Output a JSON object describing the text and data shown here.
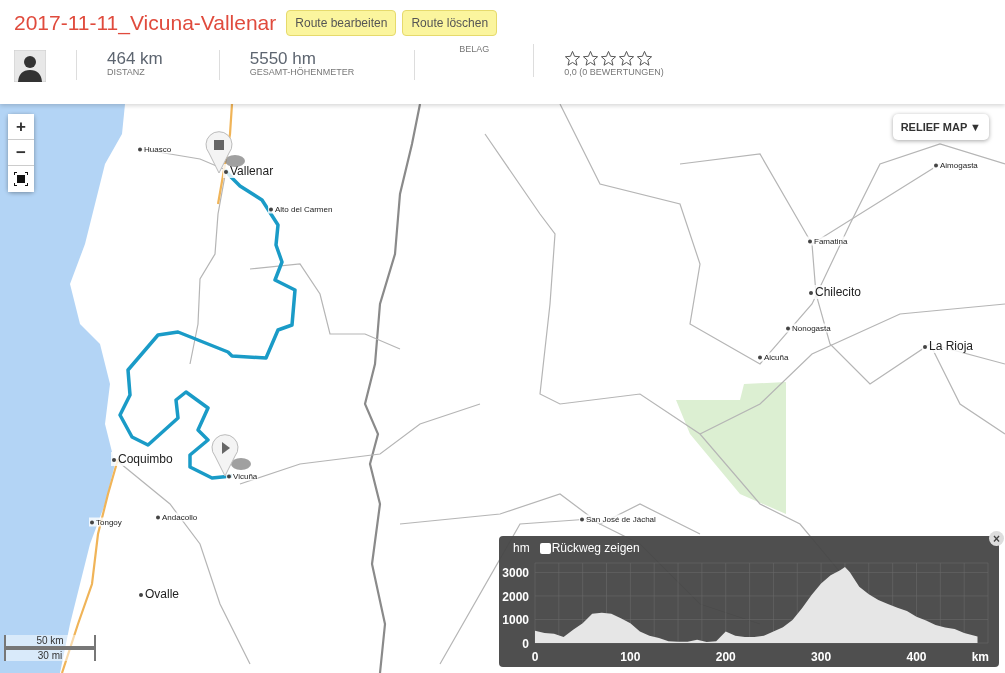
{
  "route": {
    "title": "2017-11-11_Vicuna-Vallenar",
    "buttons": [
      "Route bearbeiten",
      "Route löschen"
    ]
  },
  "stats": [
    {
      "value": "464 km",
      "label": "DISTANZ"
    },
    {
      "value": "5550 hm",
      "label": "GESAMT-HÖHENMETER"
    },
    {
      "label": "BELAG"
    }
  ],
  "rating": {
    "stars": 0,
    "text": "0,0 (0 BEWERTUNGEN)"
  },
  "map": {
    "zoom_controls": [
      "+",
      "−"
    ],
    "layer_button": "RELIEF MAP ▼",
    "places": [
      {
        "name": "Huasco",
        "kind": "town"
      },
      {
        "name": "Vallenar",
        "kind": "city"
      },
      {
        "name": "Alto del Carmen",
        "kind": "town"
      },
      {
        "name": "Aimogasta",
        "kind": "town"
      },
      {
        "name": "Famatina",
        "kind": "town"
      },
      {
        "name": "Chilecito",
        "kind": "city"
      },
      {
        "name": "Nonogasta",
        "kind": "town"
      },
      {
        "name": "La Rioja",
        "kind": "city"
      },
      {
        "name": "Aicuña",
        "kind": "town"
      },
      {
        "name": "Coquimbo",
        "kind": "city"
      },
      {
        "name": "Vicuña",
        "kind": "town"
      },
      {
        "name": "Andacollo",
        "kind": "town"
      },
      {
        "name": "Tongoy",
        "kind": "town"
      },
      {
        "name": "San José de Jáchal",
        "kind": "town"
      },
      {
        "name": "Ovalle",
        "kind": "city"
      }
    ],
    "scale": [
      "50 km",
      "30 mi"
    ]
  },
  "elevation": {
    "return_checkbox": {
      "label": "Rückweg zeigen",
      "checked": false
    },
    "close": "×",
    "chart_data": {
      "type": "area",
      "xlabel": "km",
      "ylabel": "hm",
      "grid": true,
      "x": [
        0,
        10,
        20,
        30,
        40,
        50,
        60,
        70,
        80,
        90,
        100,
        110,
        120,
        130,
        140,
        150,
        160,
        170,
        180,
        190,
        200,
        210,
        220,
        230,
        240,
        250,
        260,
        270,
        280,
        290,
        300,
        310,
        320,
        325,
        330,
        340,
        350,
        360,
        370,
        380,
        390,
        400,
        410,
        420,
        430,
        440,
        450,
        464
      ],
      "series": [
        {
          "color": "#e6e6e6",
          "values": [
            520,
            420,
            390,
            250,
            560,
            840,
            1240,
            1290,
            1240,
            1050,
            840,
            490,
            310,
            210,
            70,
            50,
            50,
            140,
            40,
            70,
            490,
            310,
            250,
            250,
            310,
            490,
            670,
            980,
            1480,
            2040,
            2530,
            2880,
            3090,
            3230,
            3020,
            2390,
            2070,
            1830,
            1660,
            1500,
            1360,
            1120,
            960,
            770,
            660,
            590,
            420,
            280
          ]
        }
      ],
      "xticks": [
        0,
        100,
        200,
        300,
        400
      ],
      "yticks": [
        0,
        1000,
        2000,
        3000
      ],
      "xlim": [
        0,
        475
      ],
      "ylim": [
        0,
        3400
      ]
    }
  }
}
